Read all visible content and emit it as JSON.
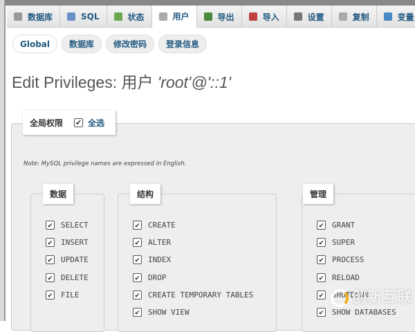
{
  "tabs": [
    {
      "label": "数据库",
      "icon": "database-icon",
      "color": "#999"
    },
    {
      "label": "SQL",
      "icon": "sql-icon",
      "color": "#6b8fc4"
    },
    {
      "label": "状态",
      "icon": "status-icon",
      "color": "#6aa84f"
    },
    {
      "label": "用户",
      "icon": "users-icon",
      "color": "#aaa",
      "active": true
    },
    {
      "label": "导出",
      "icon": "export-icon",
      "color": "#4a8a3a"
    },
    {
      "label": "导入",
      "icon": "import-icon",
      "color": "#c04040"
    },
    {
      "label": "设置",
      "icon": "wrench-icon",
      "color": "#777"
    },
    {
      "label": "复制",
      "icon": "replication-icon",
      "color": "#aaa"
    },
    {
      "label": "变量",
      "icon": "variables-icon",
      "color": "#4a8ac4"
    }
  ],
  "subnav": [
    "Global",
    "数据库",
    "修改密码",
    "登录信息"
  ],
  "title": {
    "prefix": "Edit Privileges: 用户 ",
    "user": "'root'@'::1'"
  },
  "global": {
    "legend": "全局权限",
    "check_all": "全选"
  },
  "note": "Note: MySQL privilege names are expressed in English.",
  "groups": [
    {
      "legend": "数据",
      "items": [
        "SELECT",
        "INSERT",
        "UPDATE",
        "DELETE",
        "FILE"
      ]
    },
    {
      "legend": "结构",
      "items": [
        "CREATE",
        "ALTER",
        "INDEX",
        "DROP",
        "CREATE TEMPORARY TABLES",
        "SHOW VIEW"
      ]
    },
    {
      "legend": "管理",
      "items": [
        "GRANT",
        "SUPER",
        "PROCESS",
        "RELOAD",
        "SHUTDOWN",
        "SHOW DATABASES"
      ]
    }
  ],
  "watermark": "创新互联"
}
